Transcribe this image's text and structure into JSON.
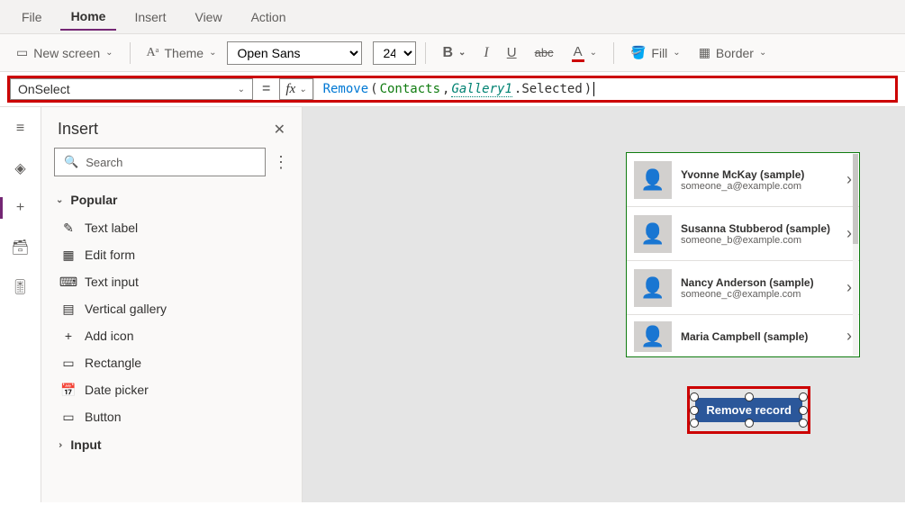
{
  "menu": {
    "items": [
      "File",
      "Home",
      "Insert",
      "View",
      "Action"
    ],
    "active": "Home"
  },
  "toolbar": {
    "newscreen": "New screen",
    "theme": "Theme",
    "font": "Open Sans",
    "size": "24",
    "fill": "Fill",
    "border": "Border"
  },
  "formula": {
    "property": "OnSelect",
    "tokens": {
      "fn": "Remove",
      "lp": "(",
      "sp": " ",
      "arg1": "Contacts",
      "comma": ",",
      "arg2": "Gallery1",
      "dot": ".Selected",
      "rp": " )"
    }
  },
  "panel": {
    "title": "Insert",
    "search_placeholder": "Search",
    "cat_popular": "Popular",
    "items": [
      "Text label",
      "Edit form",
      "Text input",
      "Vertical gallery",
      "Add icon",
      "Rectangle",
      "Date picker",
      "Button"
    ],
    "cat_input": "Input"
  },
  "gallery": {
    "rows": [
      {
        "name": "Yvonne McKay (sample)",
        "email": "someone_a@example.com"
      },
      {
        "name": "Susanna Stubberod (sample)",
        "email": "someone_b@example.com"
      },
      {
        "name": "Nancy Anderson (sample)",
        "email": "someone_c@example.com"
      },
      {
        "name": "Maria Campbell (sample)",
        "email": ""
      }
    ]
  },
  "button": {
    "label": "Remove record"
  }
}
